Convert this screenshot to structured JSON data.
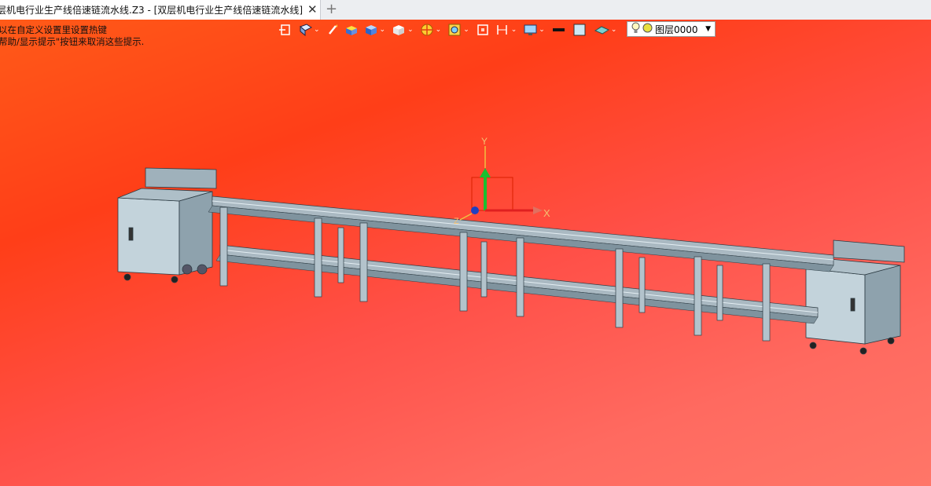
{
  "tab": {
    "title": "层机电行业生产线倍速链流水线.Z3 - [双层机电行业生产线倍速链流水线]",
    "close_icon": "close-icon",
    "new_tab_icon": "plus-icon"
  },
  "hint": {
    "line1": "以在自定义设置里设置热键",
    "line2": "帮助/显示提示\"按钮来取消这些提示."
  },
  "toolbar": {
    "icons": [
      "view-select-icon",
      "render-mode-icon",
      "pen-icon",
      "shaded-box-icon",
      "solid-cube-icon",
      "white-cube-icon",
      "section-view-icon",
      "zoom-icon",
      "fit-view-icon",
      "frame-view-icon",
      "display-icon",
      "line-color-icon",
      "fill-color-icon",
      "plane-icon"
    ],
    "layer_bulb_icon": "bulb-icon",
    "layer_status_icon": "layer-status-icon",
    "layer_value": "图层0000",
    "colors": {
      "line": "#111111",
      "fill": "#cde8f4"
    }
  },
  "triad": {
    "x_label": "X",
    "y_label": "Y",
    "z_label": "Z"
  },
  "colors": {
    "background_top": "#ff3e18",
    "background_bottom": "#ff7668",
    "model": "#b8c9d2"
  }
}
